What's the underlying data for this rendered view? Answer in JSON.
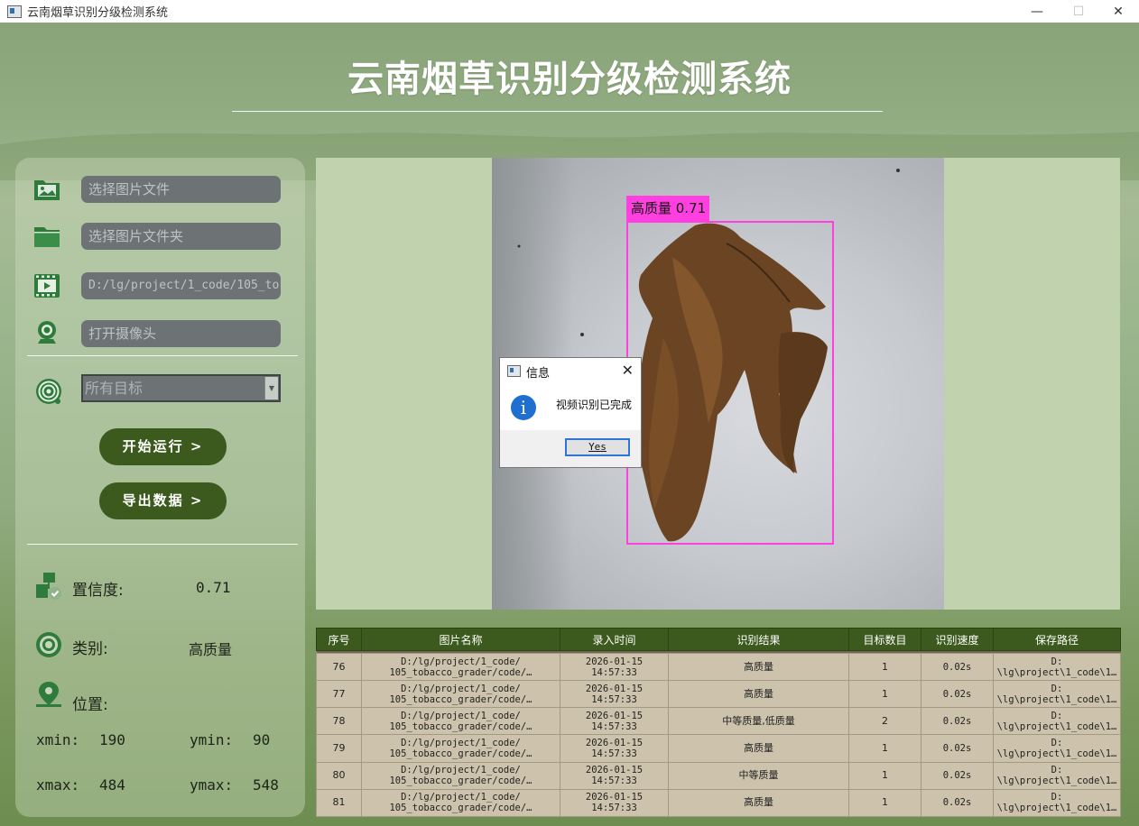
{
  "window": {
    "title": "云南烟草识别分级检测系统",
    "controls": [
      "—",
      "☐",
      "✕"
    ]
  },
  "header": {
    "title": "云南烟草识别分级检测系统"
  },
  "inputs": {
    "image_file_placeholder": "选择图片文件",
    "image_folder_placeholder": "选择图片文件夹",
    "video_path_value": "D:/lg/project/1_code/105_to",
    "camera_placeholder": "打开摄像头",
    "target_select_value": "所有目标"
  },
  "buttons": {
    "start_label": "开始运行 >",
    "export_label": "导出数据 >"
  },
  "result": {
    "confidence_label": "置信度:",
    "confidence_value": "0.71",
    "class_label": "类别:",
    "class_value": "高质量",
    "position_label": "位置:",
    "xmin_label": "xmin:",
    "xmin_value": "190",
    "ymin_label": "ymin:",
    "ymin_value": "90",
    "xmax_label": "xmax:",
    "xmax_value": "484",
    "ymax_label": "ymax:",
    "ymax_value": "548"
  },
  "detection": {
    "label": "高质量 0.71",
    "box_color": "#ff3fe0"
  },
  "dialog": {
    "title": "信息",
    "message": "视频识别已完成",
    "yes_label": "Yes",
    "icon": "info-icon"
  },
  "table": {
    "headers": [
      "序号",
      "图片名称",
      "录入时间",
      "识别结果",
      "目标数目",
      "识别速度",
      "保存路径"
    ],
    "rows": [
      {
        "id": "76",
        "name1": "D:/lg/project/1_code/",
        "name2": "105_tobacco_grader/code/…",
        "date": "2026-01-15",
        "time": "14:57:33",
        "result": "高质量",
        "count": "1",
        "speed": "0.02s",
        "path1": "D:",
        "path2": "\\lg\\project\\1_code\\1…"
      },
      {
        "id": "77",
        "name1": "D:/lg/project/1_code/",
        "name2": "105_tobacco_grader/code/…",
        "date": "2026-01-15",
        "time": "14:57:33",
        "result": "高质量",
        "count": "1",
        "speed": "0.02s",
        "path1": "D:",
        "path2": "\\lg\\project\\1_code\\1…"
      },
      {
        "id": "78",
        "name1": "D:/lg/project/1_code/",
        "name2": "105_tobacco_grader/code/…",
        "date": "2026-01-15",
        "time": "14:57:33",
        "result": "中等质量,低质量",
        "count": "2",
        "speed": "0.02s",
        "path1": "D:",
        "path2": "\\lg\\project\\1_code\\1…"
      },
      {
        "id": "79",
        "name1": "D:/lg/project/1_code/",
        "name2": "105_tobacco_grader/code/…",
        "date": "2026-01-15",
        "time": "14:57:33",
        "result": "高质量",
        "count": "1",
        "speed": "0.02s",
        "path1": "D:",
        "path2": "\\lg\\project\\1_code\\1…"
      },
      {
        "id": "80",
        "name1": "D:/lg/project/1_code/",
        "name2": "105_tobacco_grader/code/…",
        "date": "2026-01-15",
        "time": "14:57:33",
        "result": "中等质量",
        "count": "1",
        "speed": "0.02s",
        "path1": "D:",
        "path2": "\\lg\\project\\1_code\\1…"
      },
      {
        "id": "81",
        "name1": "D:/lg/project/1_code/",
        "name2": "105_tobacco_grader/code/…",
        "date": "2026-01-15",
        "time": "14:57:33",
        "result": "高质量",
        "count": "1",
        "speed": "0.02s",
        "path1": "D:",
        "path2": "\\lg\\project\\1_code\\1…"
      }
    ]
  },
  "icons": [
    "image-file-icon",
    "folder-icon",
    "video-icon",
    "camera-icon",
    "target-icon",
    "confidence-icon",
    "class-icon",
    "location-icon"
  ],
  "colors": {
    "accent_dark_green": "#3c5a1d",
    "field_gray": "#6d7274",
    "viewer_bg": "#c1d2ae",
    "table_cell": "#cdc3ac"
  }
}
